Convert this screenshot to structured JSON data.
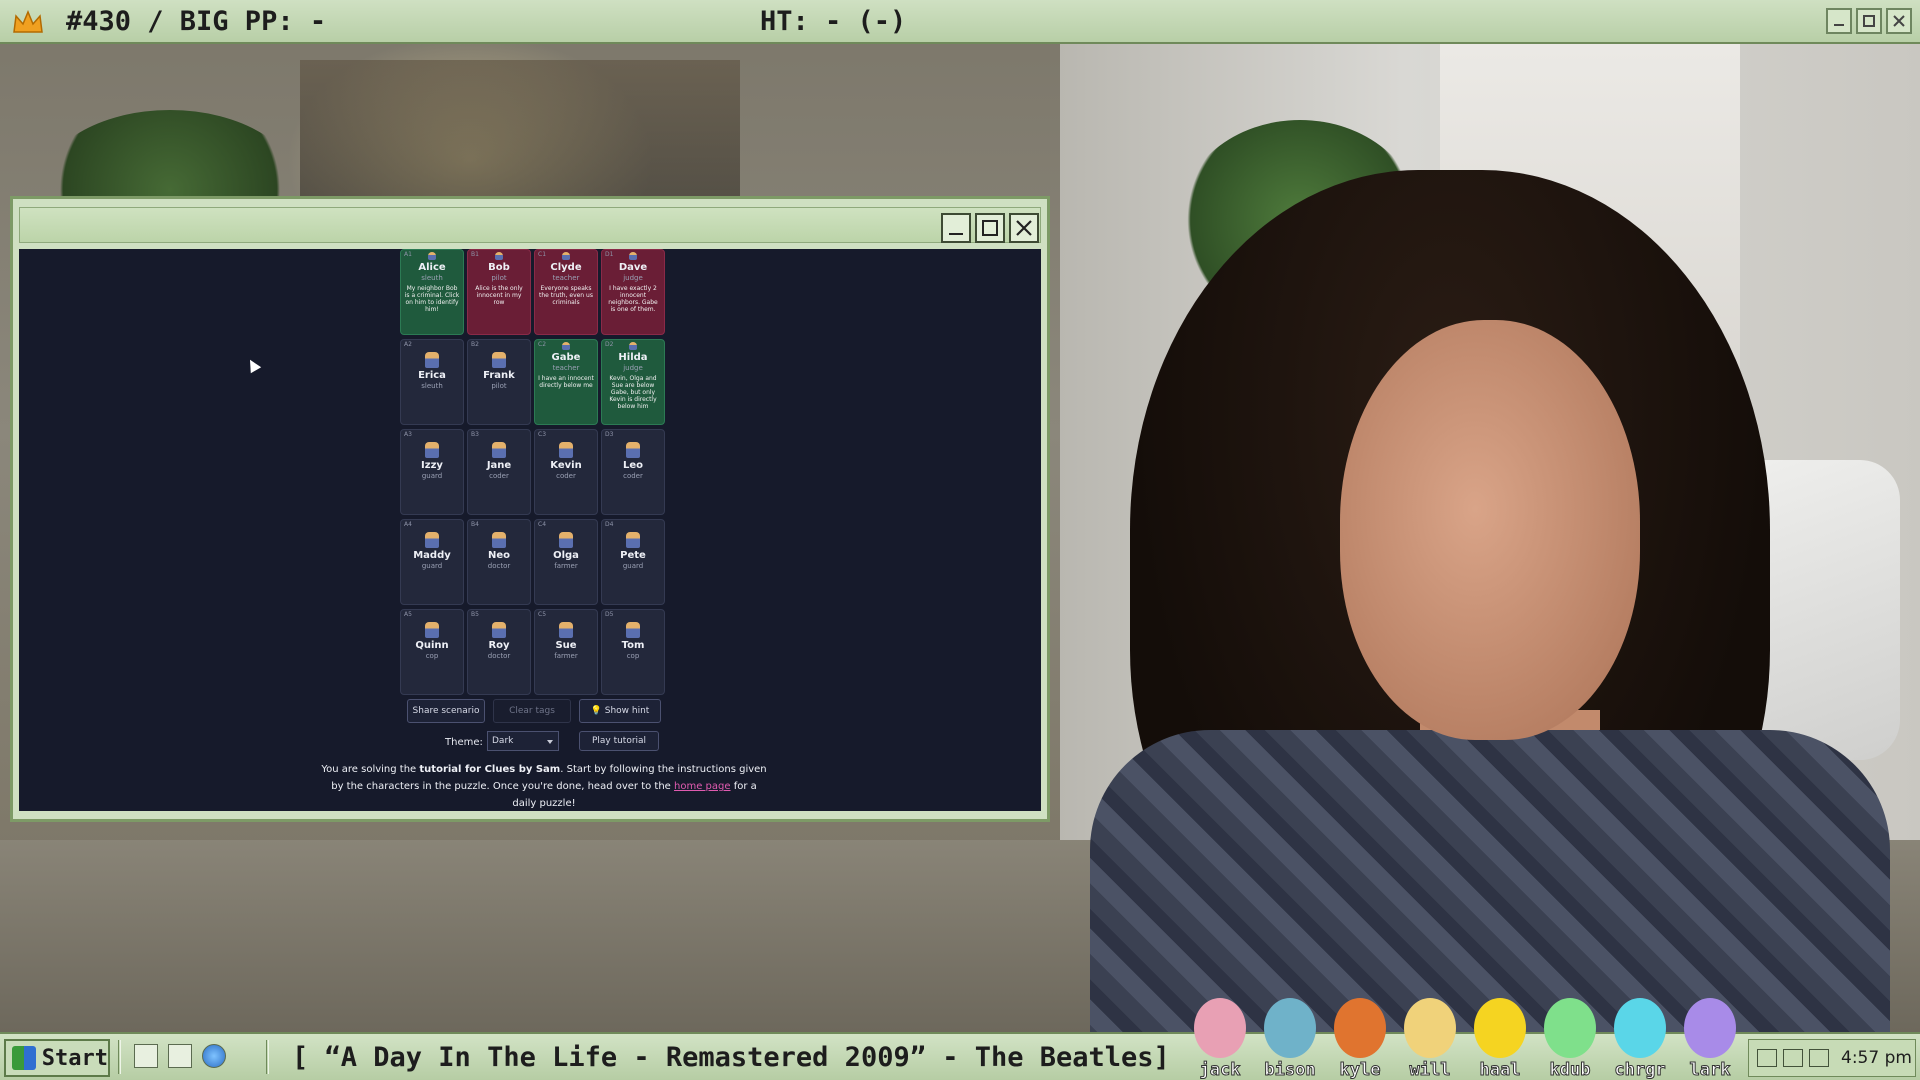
{
  "stream_bar": {
    "left_text": "#430 / BIG PP: -",
    "center_text": "HT: - (-)"
  },
  "puzzle": {
    "cards": [
      {
        "coord": "A1",
        "name": "Alice",
        "role": "sleuth",
        "state": "innocent",
        "clue": "My neighbor Bob is a criminal. Click on him to identify him!"
      },
      {
        "coord": "B1",
        "name": "Bob",
        "role": "pilot",
        "state": "criminal",
        "clue": "Alice is the only innocent in my row"
      },
      {
        "coord": "C1",
        "name": "Clyde",
        "role": "teacher",
        "state": "criminal",
        "clue": "Everyone speaks the truth, even us criminals"
      },
      {
        "coord": "D1",
        "name": "Dave",
        "role": "judge",
        "state": "criminal",
        "clue": "I have exactly 2 innocent neighbors. Gabe is one of them."
      },
      {
        "coord": "A2",
        "name": "Erica",
        "role": "sleuth",
        "state": "unknown",
        "clue": ""
      },
      {
        "coord": "B2",
        "name": "Frank",
        "role": "pilot",
        "state": "unknown",
        "clue": ""
      },
      {
        "coord": "C2",
        "name": "Gabe",
        "role": "teacher",
        "state": "innocent",
        "clue": "I have an innocent directly below me"
      },
      {
        "coord": "D2",
        "name": "Hilda",
        "role": "judge",
        "state": "innocent",
        "clue": "Kevin, Olga and Sue are below Gabe, but only Kevin is directly below him"
      },
      {
        "coord": "A3",
        "name": "Izzy",
        "role": "guard",
        "state": "unknown",
        "clue": ""
      },
      {
        "coord": "B3",
        "name": "Jane",
        "role": "coder",
        "state": "unknown",
        "clue": ""
      },
      {
        "coord": "C3",
        "name": "Kevin",
        "role": "coder",
        "state": "unknown",
        "clue": ""
      },
      {
        "coord": "D3",
        "name": "Leo",
        "role": "coder",
        "state": "unknown",
        "clue": ""
      },
      {
        "coord": "A4",
        "name": "Maddy",
        "role": "guard",
        "state": "unknown",
        "clue": ""
      },
      {
        "coord": "B4",
        "name": "Neo",
        "role": "doctor",
        "state": "unknown",
        "clue": ""
      },
      {
        "coord": "C4",
        "name": "Olga",
        "role": "farmer",
        "state": "unknown",
        "clue": ""
      },
      {
        "coord": "D4",
        "name": "Pete",
        "role": "guard",
        "state": "unknown",
        "clue": ""
      },
      {
        "coord": "A5",
        "name": "Quinn",
        "role": "cop",
        "state": "unknown",
        "clue": ""
      },
      {
        "coord": "B5",
        "name": "Roy",
        "role": "doctor",
        "state": "unknown",
        "clue": ""
      },
      {
        "coord": "C5",
        "name": "Sue",
        "role": "farmer",
        "state": "unknown",
        "clue": ""
      },
      {
        "coord": "D5",
        "name": "Tom",
        "role": "cop",
        "state": "unknown",
        "clue": ""
      }
    ],
    "buttons": {
      "share": "Share scenario",
      "clear_tags": "Clear tags",
      "show_hint": "💡 Show hint",
      "play_tutorial": "Play tutorial"
    },
    "theme_label": "Theme:",
    "theme_value": "Dark",
    "message": {
      "p1": "You are solving the ",
      "b1": "tutorial for Clues by Sam",
      "p2": ". Start by following the instructions given by the characters in the puzzle. Once you're done, head over to the ",
      "link": "home page",
      "p3": " for a daily puzzle!"
    }
  },
  "taskbar": {
    "start_label": "Start",
    "song": "[ “A Day In The Life - Remastered 2009” - The Beatles]",
    "pets": [
      {
        "label": "jack",
        "color": "#e8a0b4"
      },
      {
        "label": "bison",
        "color": "#6fb2c9"
      },
      {
        "label": "kyle",
        "color": "#e0742f"
      },
      {
        "label": "will",
        "color": "#f0d27a"
      },
      {
        "label": "haal",
        "color": "#f5d421"
      },
      {
        "label": "kdub",
        "color": "#7fe08b"
      },
      {
        "label": "chrgr",
        "color": "#5ad6e8"
      },
      {
        "label": "lark",
        "color": "#a88be8"
      }
    ],
    "clock": "4:57 pm"
  },
  "colors": {
    "chrome_green": "#cfe0c2",
    "criminal": "#6a1e36",
    "innocent": "#1f5a3d",
    "game_bg": "#161a2b"
  }
}
